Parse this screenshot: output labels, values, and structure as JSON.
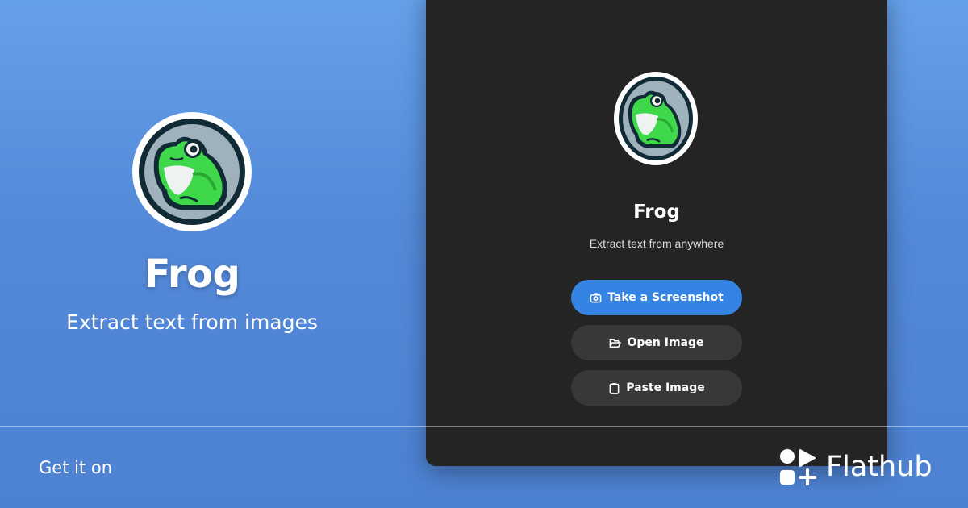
{
  "hero": {
    "app_name": "Frog",
    "tagline": "Extract text from images",
    "logo_icon": "frog-logo-icon"
  },
  "window": {
    "logo_icon": "frog-logo-icon",
    "title": "Frog",
    "subtitle": "Extract text from anywhere",
    "buttons": [
      {
        "label": "Take a Screenshot",
        "icon": "camera-icon",
        "style": "primary"
      },
      {
        "label": "Open Image",
        "icon": "folder-open-icon",
        "style": "secondary"
      },
      {
        "label": "Paste Image",
        "icon": "clipboard-icon",
        "style": "secondary"
      }
    ]
  },
  "footer": {
    "get_it_on": "Get it on",
    "store_name": "Flathub",
    "store_icon": "flathub-logo-icon"
  },
  "colors": {
    "background_top": "#65a0e8",
    "background_bottom": "#4d82d2",
    "window_bg": "#242424",
    "primary_button": "#3584e4",
    "secondary_button": "#383838",
    "frog_green": "#3fd84a"
  }
}
